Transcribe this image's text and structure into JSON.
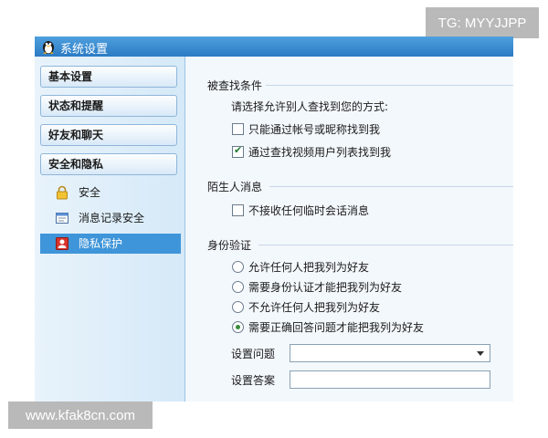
{
  "watermarks": {
    "top": "TG: MYYJJPP",
    "bottom": "www.kfak8cn.com"
  },
  "window": {
    "title": "系统设置"
  },
  "sidebar": {
    "categories": [
      {
        "label": "基本设置"
      },
      {
        "label": "状态和提醒"
      },
      {
        "label": "好友和聊天"
      },
      {
        "label": "安全和隐私"
      }
    ],
    "subitems": [
      {
        "label": "安全",
        "icon": "lock-icon"
      },
      {
        "label": "消息记录安全",
        "icon": "message-log-icon"
      },
      {
        "label": "隐私保护",
        "icon": "privacy-icon",
        "selected": true
      }
    ]
  },
  "content": {
    "find_me": {
      "title": "被查找条件",
      "prompt": "请选择允许别人查找到您的方式:",
      "options": [
        {
          "label": "只能通过帐号或昵称找到我",
          "checked": false
        },
        {
          "label": "通过查找视频用户列表找到我",
          "checked": true
        }
      ]
    },
    "stranger": {
      "title": "陌生人消息",
      "options": [
        {
          "label": "不接收任何临时会话消息",
          "checked": false
        }
      ]
    },
    "verify": {
      "title": "身份验证",
      "options": [
        {
          "label": "允许任何人把我列为好友",
          "selected": false
        },
        {
          "label": "需要身份认证才能把我列为好友",
          "selected": false
        },
        {
          "label": "不允许任何人把我列为好友",
          "selected": false
        },
        {
          "label": "需要正确回答问题才能把我列为好友",
          "selected": true
        }
      ],
      "question_label": "设置问题",
      "question_value": "",
      "answer_label": "设置答案",
      "answer_value": ""
    }
  }
}
